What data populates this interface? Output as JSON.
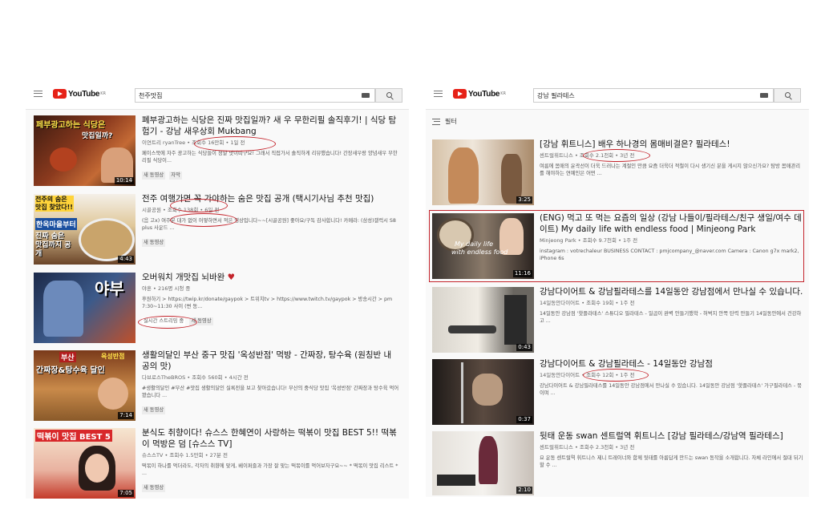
{
  "left": {
    "brand": "YouTube",
    "region": "KR",
    "search_query": "천주맛집",
    "videos": [
      {
        "title": "폐부광고하는 식당은 진짜 맛집일까? 새 우 무한리필 솔직후기! | 식당 탐험기 - 강남 새우상회 Mukbang",
        "channel": "이연트리 ryanTree",
        "views": "조회수 16만회",
        "time": "1일 전",
        "desc": "페이스북에 자주 광고하는 식당들이 정말 맛이따구요! 그래서 직접가서 솔직하게 리뷰했습니다! 간장새우랑 양념새우 무한리필 식당이...",
        "badges": [
          "새 동영상",
          "자막"
        ],
        "duration": "10:14",
        "thumb_text1": "페부광고하는 식당은",
        "thumb_text2": "맛집일까?"
      },
      {
        "title": "전주 여행가면 꼭 가야하는 숨은 맛집 공개 (택시기사님 추천 맛집)",
        "channel": "시골공원",
        "views": "조회수 138회",
        "time": "6일 전",
        "desc": "(음 고x) 여주분 대가 없이 어떻하면서 적은 영상입니다~~[시골공원] 좋아요/구독 감사합니다! 카메라: (삼성)갤럭시 S8 plus 사운드 ...",
        "badges": [
          "새 동영상"
        ],
        "duration": "4:43",
        "thumb_text1": "전주의 숨은 맛집 찾았다!!",
        "thumb_text2": "한옥마을부터",
        "thumb_text3": "진짜 숨은 맛집까지 공개"
      },
      {
        "title": "오버워치 개맛집 뇌바완",
        "channel": "야혼",
        "views": "216명 시청 중",
        "time": "",
        "desc": "후원하기 > https://twip.kr/donate/gaypok > 트위치tv > https://www.twitch.tv/gaypok > 방송시간 > pm 7:30~11:30 사이 (변 동...",
        "badges": [
          "실시간 스트리밍 중",
          "새 동영상"
        ],
        "duration": "",
        "thumb_text1": "야부"
      },
      {
        "title": "생활의달인 부산 중구 맛집 '옥성반점' 먹방 - 간짜장, 탕수육 (원칭반 내 공의 맛)",
        "channel": "다브로스TheBROS",
        "views": "조회수 560회",
        "time": "4시간 전",
        "desc": "#생활의달인 #부산 #맛집 생활의달인 실록전을 보고 찾아갔습니다! 부산의 중식당 맛집 '옥성반점' 간짜장과 탕수육 먹어봤습니다 ...",
        "badges": [
          "새 동영상"
        ],
        "duration": "7:14",
        "thumb_text1": "부산",
        "thumb_text2": "옥성반점",
        "thumb_text3": "간짜장&탕수육 달인"
      },
      {
        "title": "분식도 취향이다! 슈스스 한혜연이 사랑하는 떡볶이 맛집 BEST 5!! 떡볶이 먹방은 덤 [슈스스 TV]",
        "channel": "슈스스TV",
        "views": "조회수 1.5만회",
        "time": "27분 전",
        "desc": "떡볶이 하나를 먹더라도, 각자의 취향에 맞게, 베이퍼즐과 가장 잘 맞는 떡볶이를 먹어보자구요~~ * 떡볶이 맛집 리스트 * ...",
        "badges": [
          "새 동영상"
        ],
        "duration": "7:05",
        "thumb_text1": "떡볶이 맛집 BEST 5"
      }
    ]
  },
  "right": {
    "brand": "YouTube",
    "region": "KR",
    "search_query": "강남 필라테스",
    "filter_label": "필터",
    "videos": [
      {
        "title": "[강남 휘트니스] 배우 하나경의 몸매비결은? 필라테스!",
        "channel": "센트럴휘트니스",
        "views": "조회수 2.1천회",
        "time": "3년 전",
        "desc": "여름에 몸매의 윤곽선이 더욱 드러나는 계절인 만큼 요즘 더욱더 적철이 다시 생기신 분을 게시지 않으신가요? 탐방 몸매관리를 해야하는 연예인은 어떤 ...",
        "badges": [],
        "duration": "3:25"
      },
      {
        "title": "(ENG) 먹고 또 먹는 요즘의 일상 (강남 나들이/필라테스/친구 생일/여수 데이트) My daily life with endless food | Minjeong Park",
        "channel": "Minjeong Park",
        "views": "조회수 9.7천회",
        "time": "1주 전",
        "desc": "instagram : votrechaleur BUSINESS CONTACT : pmjcompany_@naver.com Camera : Canon g7x mark2, iPhone 6s",
        "badges": [],
        "duration": "11:16",
        "thumb_text1": "My daily life",
        "thumb_text2": "with endless food"
      },
      {
        "title": "강남다이어트 & 강남필라테스를 14일동안 강남점에서 만나실 수 있습니다.",
        "channel": "14일동안다이어트",
        "views": "조회수 19회",
        "time": "1주 전",
        "desc": "14일동안 강남점 '핫플라테스' 스튜디오 필라테스 - 일곱이 완벽 안들기했학 - 허벅지 안쪽 탄력 만들기 14일동안에서 건강하고 ...",
        "badges": [],
        "duration": "0:43"
      },
      {
        "title": "강남다이어트 & 강남필라테스 - 14일동안 강남점",
        "channel": "14일동안다이어트",
        "views": "조회수 12회",
        "time": "1주 전",
        "desc": "강남다이어트 & 강남필라테스를 14일동안 강남점에서 만나실 수 있습니다. 14일동안 강남점 '핫플라테스' 가구필라테스 - 묶이며 ...",
        "badges": [],
        "duration": "0:37"
      },
      {
        "title": "뒷태 운동 swan 센트럴역 휘트니스 [강남 필라테스/강남역 필라테스]",
        "channel": "센트럴휘트니스",
        "views": "조회수 2.3천회",
        "time": "3년 전",
        "desc": "요 운동 센트럴역 휘트니스 제니 트레이너와 함께 뒷태를 아름답게 만드는 swan 동작을 소개합니다. 자체 라인에서 절대 뒤기할 수 ...",
        "badges": [],
        "duration": "2:10"
      }
    ]
  },
  "colors": {
    "accent": "#c4242c",
    "youtube_red": "#e62117"
  },
  "icons": [
    "menu-icon",
    "youtube-logo-icon",
    "keyboard-icon",
    "search-icon",
    "filter-icon",
    "heart-icon"
  ]
}
